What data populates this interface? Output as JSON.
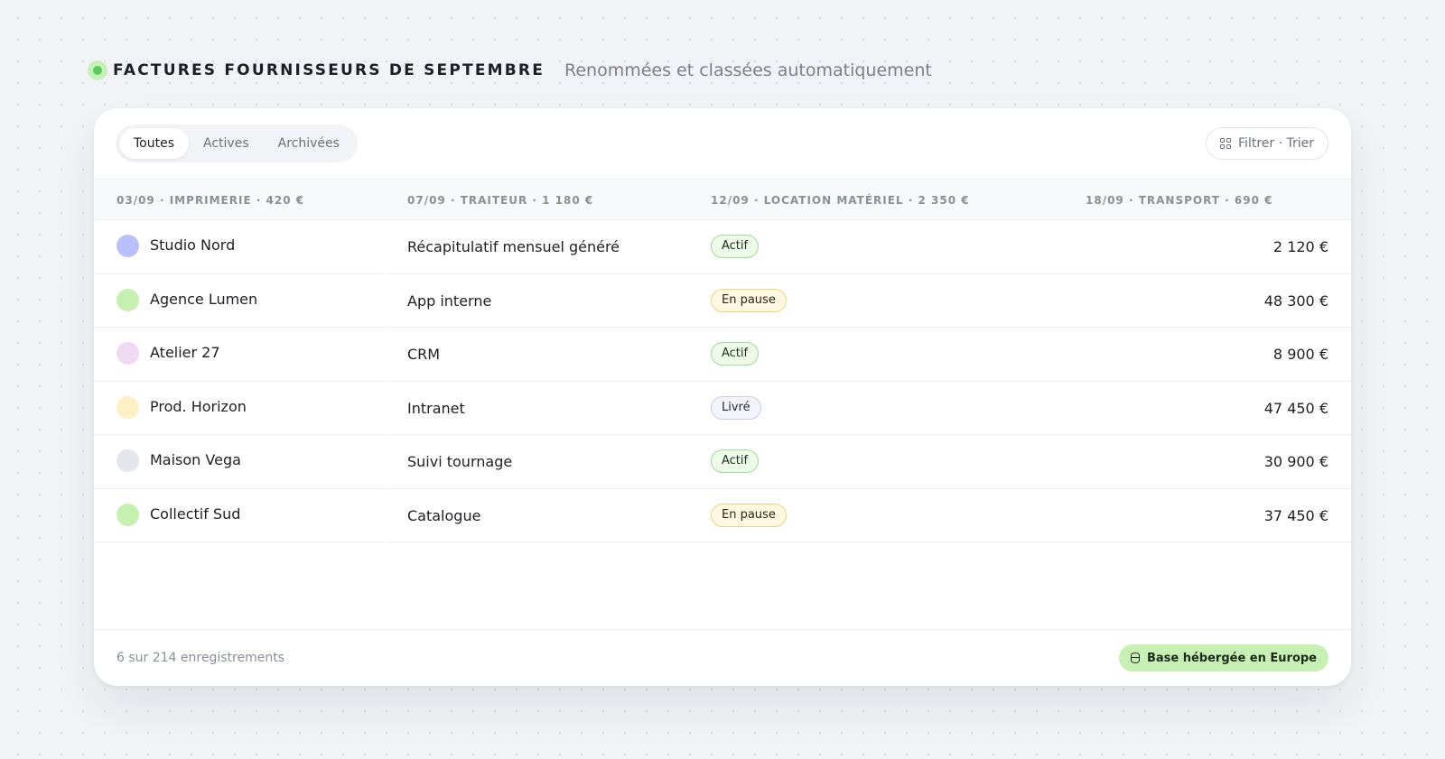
{
  "header": {
    "title": "FACTURES FOURNISSEURS DE SEPTEMBRE",
    "subtitle": "Renommées et classées automatiquement"
  },
  "tabs": [
    {
      "label": "Toutes",
      "active": true
    },
    {
      "label": "Actives",
      "active": false
    },
    {
      "label": "Archivées",
      "active": false
    }
  ],
  "filter_button": {
    "label": "Filtrer · Trier",
    "icon": "grid-icon"
  },
  "columns": [
    "03/09 · IMPRIMERIE · 420 €",
    "07/09 · TRAITEUR · 1 180 €",
    "12/09 · LOCATION MATÉRIEL · 2 350 €",
    "18/09 · TRANSPORT · 690 €"
  ],
  "rows": [
    {
      "client": "Studio Nord",
      "avatar_color": "#b9c0fb",
      "project": "Récapitulatif mensuel généré",
      "status": "Actif",
      "status_kind": "actif",
      "amount": "2 120 €"
    },
    {
      "client": "Agence Lumen",
      "avatar_color": "#c6f0b0",
      "project": "App interne",
      "status": "En pause",
      "status_kind": "pause",
      "amount": "48 300 €"
    },
    {
      "client": "Atelier 27",
      "avatar_color": "#f0d9f2",
      "project": "CRM",
      "status": "Actif",
      "status_kind": "actif",
      "amount": "8 900 €"
    },
    {
      "client": "Prod. Horizon",
      "avatar_color": "#fdf0c2",
      "project": "Intranet",
      "status": "Livré",
      "status_kind": "livre",
      "amount": "47 450 €"
    },
    {
      "client": "Maison Vega",
      "avatar_color": "#e4e6ee",
      "project": "Suivi tournage",
      "status": "Actif",
      "status_kind": "actif",
      "amount": "30 900 €"
    },
    {
      "client": "Collectif Sud",
      "avatar_color": "#c6f0b0",
      "project": "Catalogue",
      "status": "En pause",
      "status_kind": "pause",
      "amount": "37 450 €"
    }
  ],
  "footer": {
    "count_text": "6 sur 214 enregistrements",
    "hosting_badge": "Base hébergée en Europe",
    "hosting_icon": "database-icon"
  },
  "colors": {
    "accent_green": "#59c95c",
    "badge_green": "#c7f0b5"
  }
}
